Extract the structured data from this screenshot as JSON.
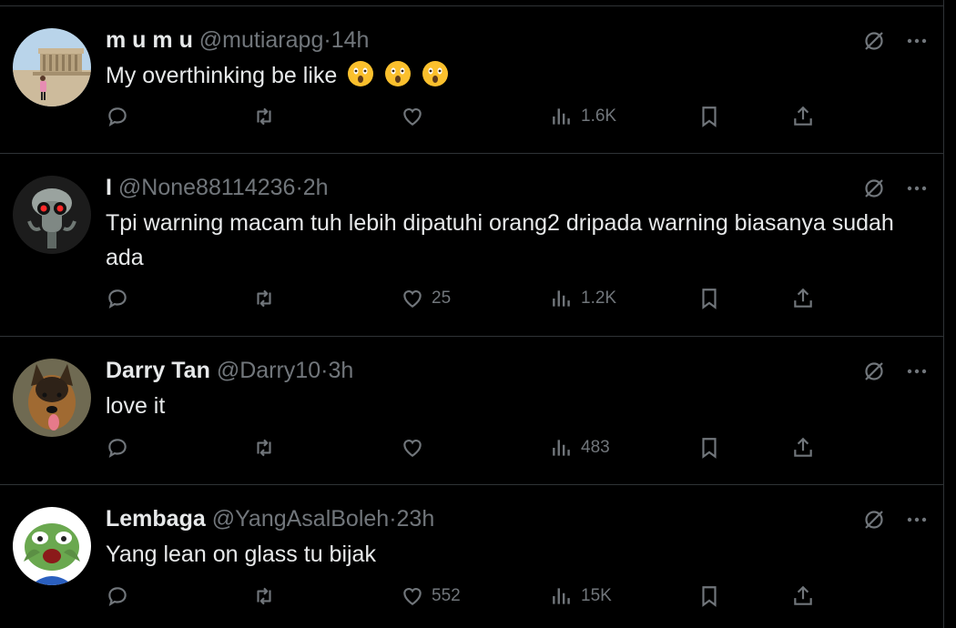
{
  "tweets": [
    {
      "name": "m u m u",
      "handle": "@mutiarapg",
      "sep": "·",
      "time": "14h",
      "text": "My overthinking be like",
      "emojis": [
        "astonished-face",
        "astonished-face",
        "astonished-face"
      ],
      "likes": "",
      "views": "1.6K",
      "avatar": "monument-photo"
    },
    {
      "name": "I",
      "handle": "@None88114236",
      "sep": "·",
      "time": "2h",
      "text": "Tpi warning macam tuh lebih dipatuhi orang2 dripada warning biasanya sudah ada",
      "likes": "25",
      "views": "1.2K",
      "avatar": "squidward-red-eyes"
    },
    {
      "name": "Darry Tan",
      "handle": "@Darry10",
      "sep": "·",
      "time": "3h",
      "text": "love it",
      "likes": "",
      "views": "483",
      "avatar": "german-shepherd"
    },
    {
      "name": "Lembaga",
      "handle": "@YangAsalBoleh",
      "sep": "·",
      "time": "23h",
      "text": "Yang lean on glass tu bijak",
      "likes": "552",
      "views": "15K",
      "avatar": "pepe-frog-crying"
    }
  ],
  "icons": [
    "reply-icon",
    "retweet-icon",
    "like-icon",
    "views-icon",
    "bookmark-icon",
    "share-icon",
    "grok-icon",
    "more-icon"
  ],
  "colors": {
    "background": "#000000",
    "text": "#e7e9ea",
    "secondary": "#71767b",
    "divider": "#2f3336"
  }
}
